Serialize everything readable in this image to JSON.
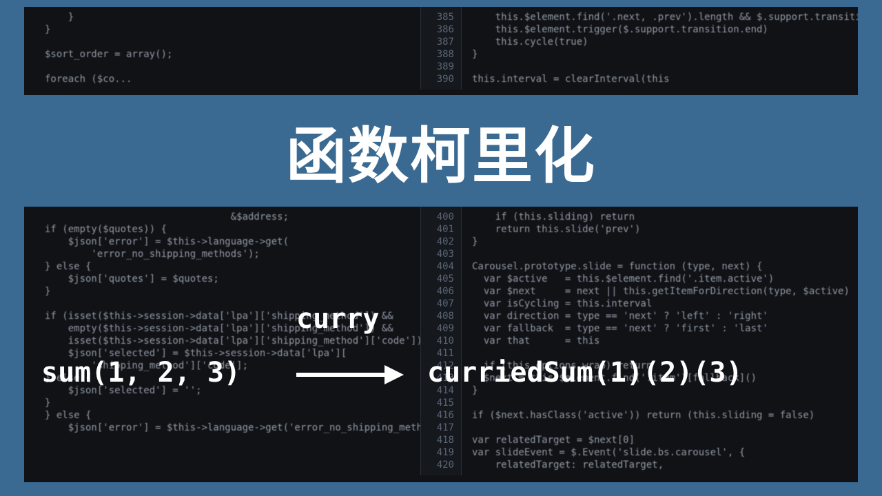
{
  "title": "函数柯里化",
  "curry_label": "curry",
  "expr_left": "sum(1, 2, 3)",
  "expr_right": "curriedSum(1)(2)(3)",
  "line_numbers_top": "385\n386\n387\n388\n389\n390",
  "line_numbers_bottom": "400\n401\n402\n403\n404\n405\n406\n407\n408\n409\n410\n411\n412\n413\n414\n415\n416\n417\n418\n419\n420",
  "code_top_left": "    }\n}\n\n$sort_order = array();\n\nforeach ($co...",
  "code_top_right": "    this.$element.find('.next, .prev').length && $.support.transition) {\n    this.$element.trigger($.support.transition.end)\n    this.cycle(true)\n}\n\nthis.interval = clearInterval(this",
  "code_bottom_left": "                                &$address;\nif (empty($quotes)) {\n    $json['error'] = $this->language->get(\n        'error_no_shipping_methods');\n} else {\n    $json['quotes'] = $quotes;\n}\n\nif (isset($this->session->data['lpa']['shipping_method']) &&\n    empty($this->session->data['lpa']['shipping_method']) &&\n    isset($this->session->data['lpa']['shipping_method']['code'])) {\n    $json['selected'] = $this->session->data['lpa'][\n        'shipping_method']['code'];\n} else {\n    $json['selected'] = '';\n}\n} else {\n    $json['error'] = $this->language->get('error_no_shipping_methods');",
  "code_bottom_right": "    if (this.sliding) return\n    return this.slide('prev')\n}\n\nCarousel.prototype.slide = function (type, next) {\n  var $active   = this.$element.find('.item.active')\n  var $next     = next || this.getItemForDirection(type, $active)\n  var isCycling = this.interval\n  var direction = type == 'next' ? 'left' : 'right'\n  var fallback  = type == 'next' ? 'first' : 'last'\n  var that      = this\n\n  if (this.options.wrap) return\n  $next = this.$element.find('.item')[fallback]()\n}\n\nif ($next.hasClass('active')) return (this.sliding = false)\n\nvar relatedTarget = $next[0]\nvar slideEvent = $.Event('slide.bs.carousel', {\n    relatedTarget: relatedTarget,"
}
